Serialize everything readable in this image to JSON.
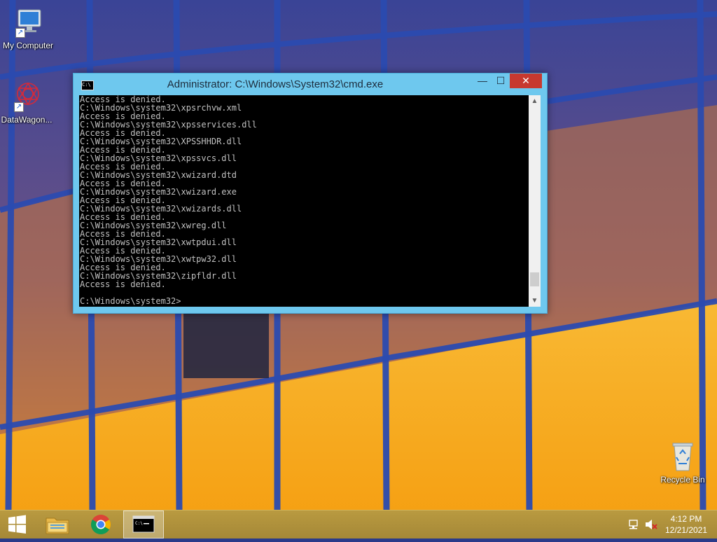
{
  "desktop": {
    "icons": [
      {
        "label": "My Computer",
        "icon": "computer-icon"
      },
      {
        "label": "DataWagon...",
        "icon": "datawagon-icon"
      },
      {
        "label": "Recycle Bin",
        "icon": "recycle-bin-icon"
      }
    ]
  },
  "window": {
    "title": "Administrator: C:\\Windows\\System32\\cmd.exe",
    "icon": "cmd-icon",
    "minimize_glyph": "—",
    "maximize_glyph": "☐",
    "close_glyph": "✕",
    "output": "Access is denied.\nC:\\Windows\\system32\\xpsrchvw.xml\nAccess is denied.\nC:\\Windows\\system32\\xpsservices.dll\nAccess is denied.\nC:\\Windows\\system32\\XPSSHHDR.dll\nAccess is denied.\nC:\\Windows\\system32\\xpssvcs.dll\nAccess is denied.\nC:\\Windows\\system32\\xwizard.dtd\nAccess is denied.\nC:\\Windows\\system32\\xwizard.exe\nAccess is denied.\nC:\\Windows\\system32\\xwizards.dll\nAccess is denied.\nC:\\Windows\\system32\\xwreg.dll\nAccess is denied.\nC:\\Windows\\system32\\xwtpdui.dll\nAccess is denied.\nC:\\Windows\\system32\\xwtpw32.dll\nAccess is denied.\nC:\\Windows\\system32\\zipfldr.dll\nAccess is denied.\n\nC:\\Windows\\system32>",
    "scrollbar_position": 0.95
  },
  "taskbar": {
    "items": [
      {
        "name": "start",
        "icon": "windows-logo-icon"
      },
      {
        "name": "file-explorer",
        "icon": "folder-icon"
      },
      {
        "name": "chrome",
        "icon": "chrome-icon"
      },
      {
        "name": "command-prompt",
        "icon": "cmd-icon",
        "active": true
      }
    ],
    "tray": {
      "network_icon": "network-icon",
      "volume_icon": "volume-muted-icon",
      "time": "4:12 PM",
      "date": "12/21/2021"
    }
  },
  "colors": {
    "window_frame": "#6ec8ee",
    "close_button": "#c7392f",
    "console_background": "#000000",
    "console_text": "#c0c0c0",
    "taskbar": "#b99a40"
  }
}
